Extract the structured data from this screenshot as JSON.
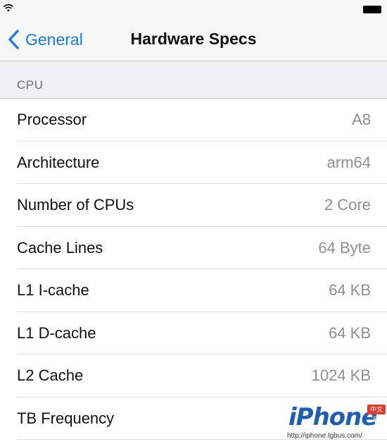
{
  "status_bar": {
    "wifi_icon": "wifi-icon",
    "battery_icon": "battery-icon"
  },
  "nav": {
    "back_label": "General",
    "title": "Hardware Specs",
    "accent_color": "#1a7bf2"
  },
  "section": {
    "header": "CPU"
  },
  "rows": [
    {
      "label": "Processor",
      "value": "A8"
    },
    {
      "label": "Architecture",
      "value": "arm64"
    },
    {
      "label": "Number of CPUs",
      "value": "2 Core"
    },
    {
      "label": "Cache Lines",
      "value": "64 Byte"
    },
    {
      "label": "L1 I-cache",
      "value": "64 KB"
    },
    {
      "label": "L1 D-cache",
      "value": "64 KB"
    },
    {
      "label": "L2 Cache",
      "value": "1024 KB"
    },
    {
      "label": "TB Frequency",
      "value": ""
    }
  ],
  "watermark": {
    "logo_text": "iPhone",
    "badge": "中文网",
    "url": "http://iphone.tgbus.com/"
  }
}
